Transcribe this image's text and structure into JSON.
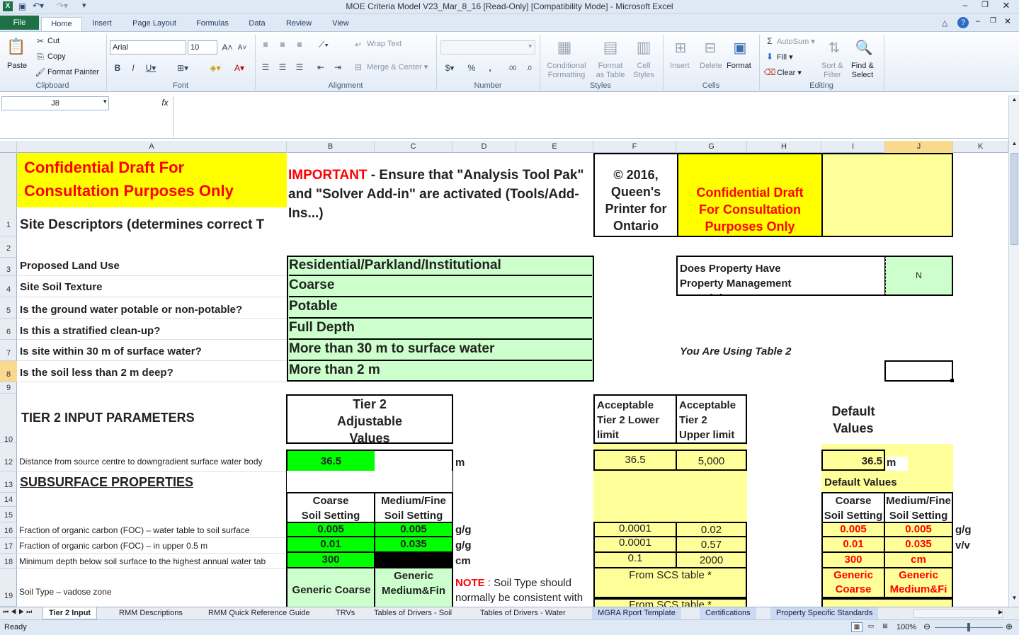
{
  "window": {
    "title": "MOE Criteria Model V23_Mar_8_16  [Read-Only]  [Compatibility Mode]  -  Microsoft Excel"
  },
  "ribbon": {
    "tabs": [
      "File",
      "Home",
      "Insert",
      "Page Layout",
      "Formulas",
      "Data",
      "Review",
      "View"
    ],
    "clipboard": {
      "paste": "Paste",
      "cut": "Cut",
      "copy": "Copy",
      "format_painter": "Format Painter",
      "label": "Clipboard"
    },
    "font": {
      "name": "Arial",
      "size": "10",
      "label": "Font"
    },
    "alignment": {
      "wrap": "Wrap Text",
      "merge": "Merge & Center",
      "label": "Alignment"
    },
    "number": {
      "label": "Number"
    },
    "styles": {
      "cond": "Conditional",
      "cond2": "Formatting",
      "fmt_table": "Format",
      "fmt_table2": "as Table",
      "cell_styles": "Cell",
      "cell_styles2": "Styles",
      "label": "Styles"
    },
    "cells": {
      "insert": "Insert",
      "delete": "Delete",
      "format": "Format",
      "label": "Cells"
    },
    "editing": {
      "autosum": "AutoSum",
      "fill": "Fill",
      "clear": "Clear",
      "sort": "Sort &",
      "sort2": "Filter",
      "find": "Find &",
      "find2": "Select",
      "label": "Editing"
    }
  },
  "formula_bar": {
    "name_box": "J8",
    "fx": "fx",
    "content": ""
  },
  "columns": [
    "A",
    "B",
    "C",
    "D",
    "E",
    "F",
    "G",
    "H",
    "I",
    "J",
    "K"
  ],
  "rows": [
    "1",
    "2",
    "3",
    "4",
    "5",
    "6",
    "7",
    "8",
    "9",
    "10",
    "12",
    "13",
    "14",
    "15",
    "16",
    "17",
    "18",
    "19"
  ],
  "cells": {
    "a1_conf": "Confidential Draft For\nConsultation Purposes Only",
    "a1_site": "Site Descriptors (determines correct T",
    "b1_imp": "IMPORTANT",
    "b1_rest": " - Ensure that \"Analysis Tool Pak\" and \"Solver Add-in\" are activated (Tools/Add-Ins...)",
    "f1": "© 2016, Queen's Printer for Ontario",
    "g1": "Confidential Draft For Consultation Purposes Only",
    "a3": "Proposed Land Use",
    "b3": "Residential/Parkland/Institutional",
    "a4": "Site Soil Texture",
    "b4": "Coarse",
    "a5": "Is the ground water potable or non-potable?",
    "b5": "Potable",
    "a6": "Is this a stratified clean-up?",
    "b6": "Full Depth",
    "a7": "Is site within 30 m of surface water?",
    "b7": "More than 30 m to surface water",
    "a8": "Is the soil less than 2 m deep?",
    "b8": "More than 2 m",
    "g3": "Does Property Have Property Management Oversight",
    "j3": "N",
    "g7": "You Are Using Table 2",
    "a10": "TIER 2 INPUT PARAMETERS",
    "b10": "Tier 2\nAdjustable\nValues",
    "f10": "Acceptable\nTier 2 Lower\nlimit",
    "g10": "Acceptable\nTier 2\nUpper limit",
    "i10": "Default\nValues",
    "a12": "Distance from source centre to downgradient surface water body",
    "b12": "36.5",
    "d12": "m",
    "f12": "36.5",
    "g12": "5,000",
    "i12": "36.5",
    "j12": "m",
    "a13": "SUBSURFACE PROPERTIES",
    "i13": "Default Values",
    "b14": "Coarse\nSoil Setting",
    "c14": "Medium/Fine\nSoil Setting",
    "i14": "Coarse\nSoil Setting",
    "j14": "Medium/Fine\nSoil Setting",
    "a16": "Fraction of organic carbon (FOC) – water table to soil surface",
    "b16": "0.005",
    "c16": "0.005",
    "d16": "g/g",
    "f16": "0.0001",
    "g16": "0.02",
    "i16": "0.005",
    "j16": "0.005",
    "k16": "g/g",
    "a17": "Fraction of organic carbon (FOC) – in upper 0.5 m",
    "b17": "0.01",
    "c17": "0.035",
    "d17": "g/g",
    "f17": "0.0001",
    "g17": "0.57",
    "i17": "0.01",
    "j17": "0.035",
    "k17": "v/v",
    "a18": "Minimum depth below soil surface to the highest annual water tab",
    "b18": "300",
    "d18": "cm",
    "f18": "0.1",
    "g18": "2000",
    "i18": "300",
    "j18": "cm",
    "a19": "Soil Type – vadose zone",
    "b19": "Generic Coarse",
    "c19": "Generic\nMedium&Fin",
    "d19_note": "NOTE",
    "d19_rest": " : Soil Type should normally be consistent with",
    "f19": "From SCS table *",
    "f20": "From SCS table *",
    "i19": "Generic\nCoarse",
    "j19": "Generic\nMedium&Fi"
  },
  "sheet_tabs": [
    "Tier 2 Input",
    "RMM Descriptions",
    "RMM Quick Reference Guide",
    "TRVs",
    "Tables of Drivers - Soil",
    "Tables of Drivers - Water",
    "MGRA Rport Template",
    "Certifications",
    "Property Specific Standards"
  ],
  "status": {
    "ready": "Ready",
    "zoom": "100%"
  },
  "colors": {
    "green": "#ccffcc",
    "bright_green": "#00ff00",
    "yellow": "#ffff00",
    "light_yellow": "#ffff99",
    "red": "#ff0000",
    "select": "#f9d98c"
  }
}
